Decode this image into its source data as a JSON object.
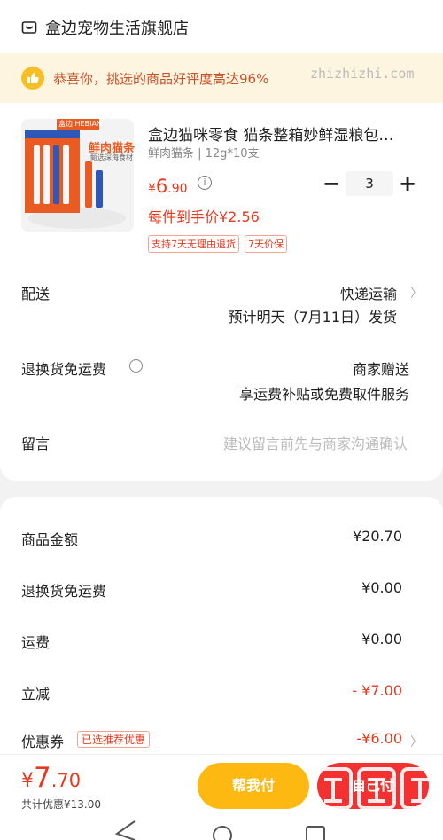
{
  "shop": {
    "name": "盒边宠物生活旗舰店",
    "icon": "store-icon"
  },
  "banner": {
    "text": "恭喜你，挑选的商品好评度高达96%",
    "icon": "thumbs-up-icon"
  },
  "product": {
    "image_brand": "盒边 HEBIAN",
    "image_caption": "鲜肉猫条",
    "image_subcaption": "甄选深海食材",
    "title": "盒边猫咪零食 猫条整箱妙鲜湿粮包…",
    "spec": "鲜肉猫条 | 12g*10支",
    "price_symbol": "¥",
    "price_int": "6",
    "price_dec": ".90",
    "quantity": "3",
    "unit_price": "每件到手价¥2.56",
    "tags": [
      "支持7天无理由退货",
      "7天价保"
    ]
  },
  "rows": {
    "delivery_label": "配送",
    "delivery_method": "快递运输",
    "delivery_eta": "预计明天（7月11日）发货",
    "return_label": "退换货免运费",
    "return_value": "商家赠送",
    "return_detail": "享运费补贴或免费取件服务",
    "message_label": "留言",
    "message_placeholder": "建议留言前先与商家沟通确认"
  },
  "summary": {
    "goods_label": "商品金额",
    "goods_value": "¥20.70",
    "return_label": "退换货免运费",
    "return_value": "¥0.00",
    "shipping_label": "运费",
    "shipping_value": "¥0.00",
    "instant_label": "立减",
    "instant_value": "- ¥7.00",
    "coupon_label": "优惠券",
    "coupon_tag": "已选推荐优惠",
    "coupon_value": "-¥6.00"
  },
  "footer": {
    "total_symbol": "¥",
    "total_int": "7",
    "total_dec": ".70",
    "discount": "共计优惠¥13.00",
    "help_pay": "帮我付",
    "pay": "自己付",
    "watermark_site": "zhizhizhi.com"
  },
  "colors": {
    "accent_red": "#e8381d",
    "button_yellow": "#fdb812",
    "button_red": "#f53030",
    "banner_bg": "#fdf5df"
  }
}
